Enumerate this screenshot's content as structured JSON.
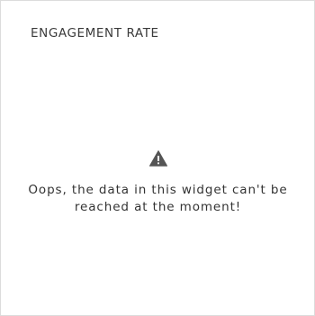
{
  "widget": {
    "title": "ENGAGEMENT RATE",
    "error": {
      "icon": "warning-icon",
      "message": "Oops, the data in this widget can't be reached at the moment!"
    }
  },
  "colors": {
    "border": "#dcdcdc",
    "text": "#333333",
    "icon": "#555555"
  }
}
